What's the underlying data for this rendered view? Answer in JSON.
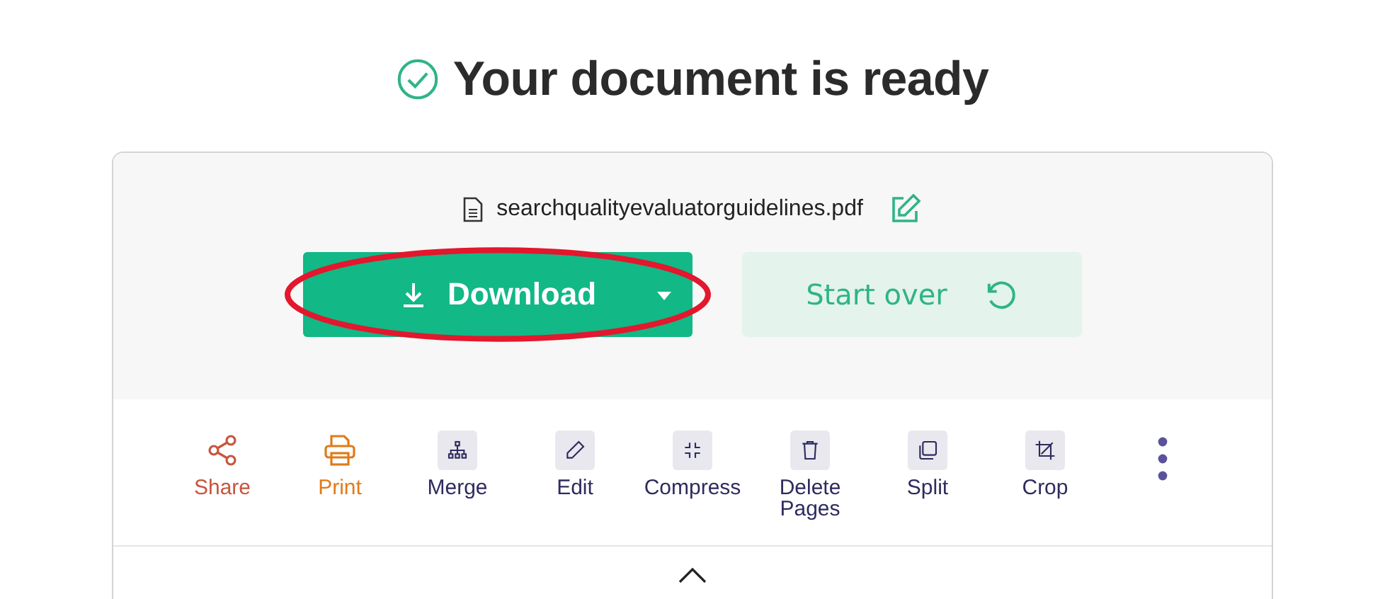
{
  "heading": "Your document is ready",
  "file": {
    "name": "searchqualityevaluatorguidelines.pdf"
  },
  "download_button": {
    "label": "Download"
  },
  "start_over_button": {
    "label": "Start over"
  },
  "annotation": {
    "kind": "ellipse",
    "color": "#e3172d"
  },
  "tools": [
    {
      "kind": "share",
      "label": "Share",
      "color": "#c8553d"
    },
    {
      "kind": "print",
      "label": "Print",
      "color": "#e07b1a"
    },
    {
      "kind": "merge",
      "label": "Merge",
      "color": "#2e2b5f"
    },
    {
      "kind": "edit",
      "label": "Edit",
      "color": "#2e2b5f"
    },
    {
      "kind": "compress",
      "label": "Compress",
      "color": "#2e2b5f"
    },
    {
      "kind": "delete",
      "label": "Delete Pages",
      "color": "#2e2b5f"
    },
    {
      "kind": "split",
      "label": "Split",
      "color": "#2e2b5f"
    },
    {
      "kind": "crop",
      "label": "Crop",
      "color": "#2e2b5f"
    }
  ]
}
